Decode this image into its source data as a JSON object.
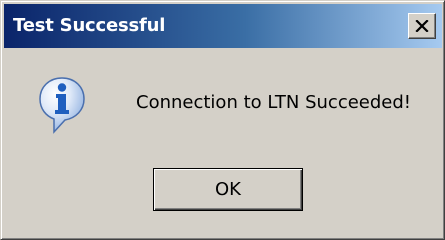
{
  "dialog": {
    "title": "Test Successful",
    "icon": "info-icon",
    "message": "Connection to LTN Succeeded!",
    "ok_label": "OK",
    "close_icon": "close-icon"
  },
  "colors": {
    "titlebar_start": "#0a246a",
    "titlebar_end": "#a6caf0",
    "face": "#d4d0c8",
    "icon_blue": "#1f5fbf"
  }
}
